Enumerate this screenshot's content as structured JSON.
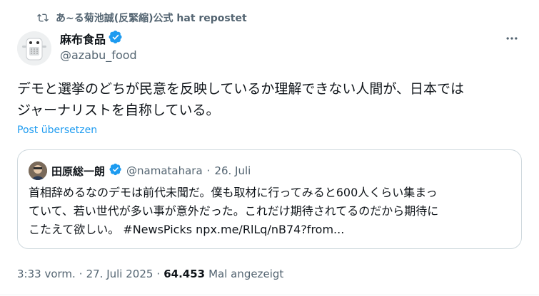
{
  "repost": {
    "text": "あ~る菊池誠(反緊縮)公式 hat repostet"
  },
  "author": {
    "name": "麻布食品",
    "handle": "@azabu_food"
  },
  "tweet": {
    "text_line1": "デモと選挙のどちが民意を反映しているか理解できない人間が、日本では",
    "text_line2": "ジャーナリストを自称している。",
    "translate_label": "Post übersetzen"
  },
  "quote": {
    "name": "田原総一朗",
    "handle": "@namatahara",
    "separator": "·",
    "date": "26. Juli",
    "line1": "首相辞めるなのデモは前代未聞だ。僕も取材に行ってみると600人くらい集まっ",
    "line2": "ていて、若い世代が多い事が意外だった。これだけ期待されてるのだから期待に",
    "line3": "こたえて欲しい。 #NewsPicks npx.me/RlLq/nB74?from..."
  },
  "meta": {
    "time": "3:33 vorm.",
    "separator": "·",
    "date": "27. Juli 2025",
    "separator2": "·",
    "views": "64.453",
    "views_label": "Mal angezeigt"
  },
  "colors": {
    "accent": "#1d9bf0",
    "muted": "#536471",
    "text": "#0f1419",
    "border": "#cfd9de"
  },
  "icons": {
    "repost": "repost-icon",
    "verified": "verified-badge-icon",
    "more": "more-dots-icon"
  }
}
